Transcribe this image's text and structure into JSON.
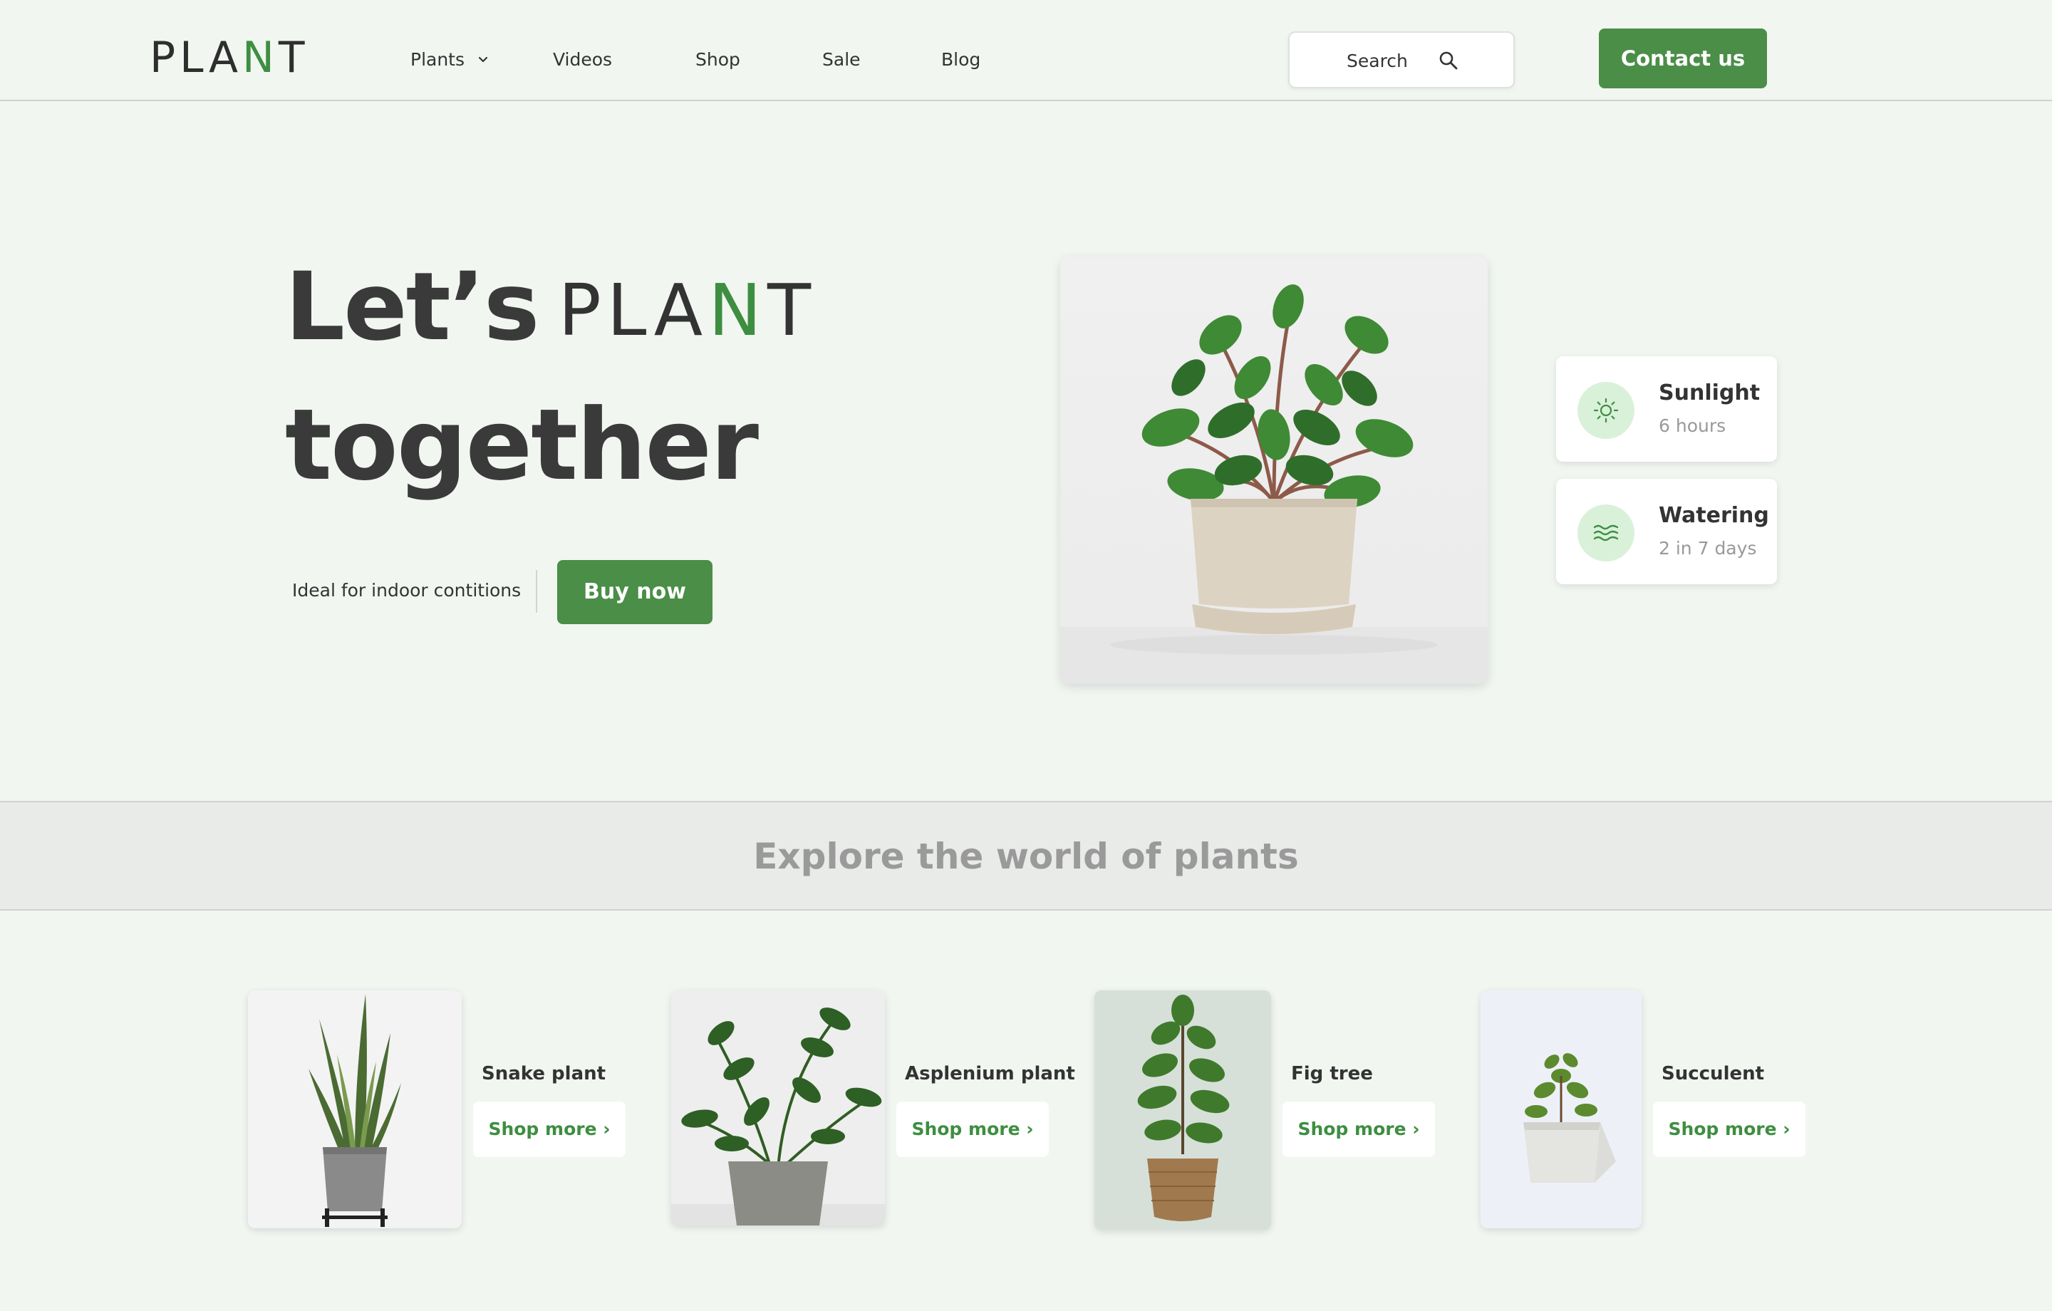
{
  "header": {
    "logo": {
      "pre": "PLA",
      "accent": "N",
      "post": "T"
    },
    "nav": [
      "Plants",
      "Videos",
      "Shop",
      "Sale",
      "Blog"
    ],
    "search_label": "Search",
    "contact_label": "Contact us"
  },
  "hero": {
    "title_word": "Let’s",
    "logo": {
      "pre": "PLA",
      "accent": "N",
      "post": "T"
    },
    "title_line2": "together",
    "subtitle": "Ideal for indoor contitions",
    "buy_label": "Buy now"
  },
  "care": [
    {
      "title": "Sunlight",
      "detail": "6 hours",
      "icon": "sun-icon"
    },
    {
      "title": "Watering",
      "detail": "2 in 7 days",
      "icon": "water-waves-icon"
    }
  ],
  "band": {
    "title": "Explore the world of plants"
  },
  "products": [
    {
      "name": "Snake plant",
      "cta": "Shop  more ›"
    },
    {
      "name": "Asplenium plant",
      "cta": "Shop  more ›"
    },
    {
      "name": "Fig  tree",
      "cta": "Shop  more ›"
    },
    {
      "name": "Succulent",
      "cta": "Shop  more ›"
    }
  ],
  "colors": {
    "accent": "#4a8e47",
    "background": "#f1f6f1",
    "band": "#e8ebe7",
    "icon_bg": "#d9f1d9"
  }
}
